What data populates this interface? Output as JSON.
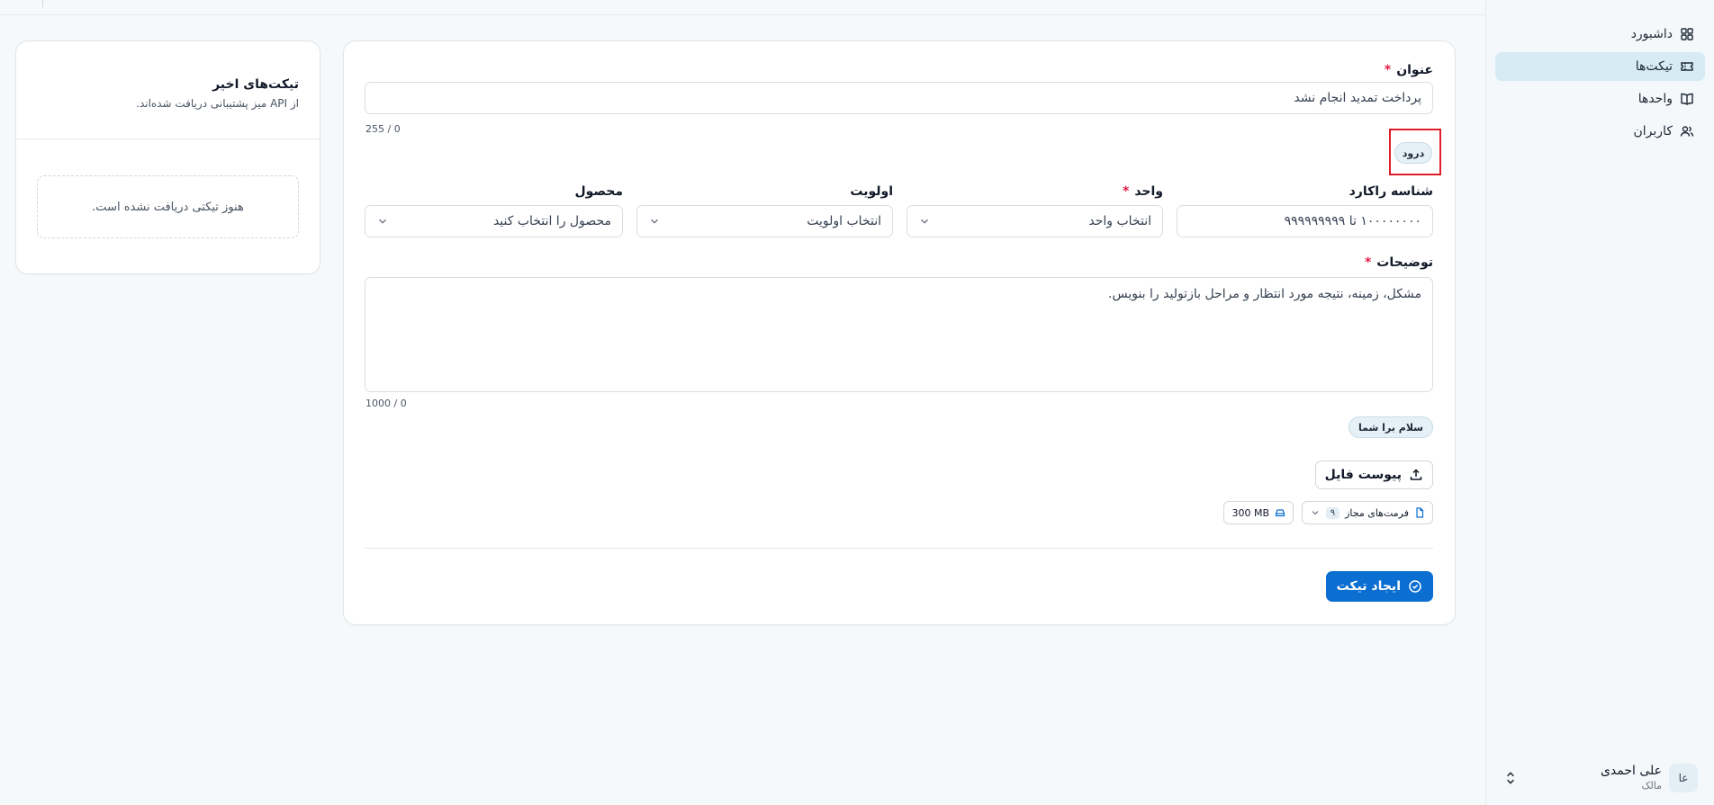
{
  "sidebar": {
    "items": [
      {
        "label": "داشبورد",
        "icon": "dashboard-icon",
        "active": false
      },
      {
        "label": "تیکت‌ها",
        "icon": "ticket-icon",
        "active": true
      },
      {
        "label": "واحدها",
        "icon": "book-icon",
        "active": false
      },
      {
        "label": "کاربران",
        "icon": "users-icon",
        "active": false
      }
    ],
    "user": {
      "initials": "عا",
      "name": "علی احمدی",
      "role": "مالک"
    }
  },
  "form": {
    "title_label": "عنوان",
    "title_value": "پرداخت تمدید انجام نشد",
    "title_counter": "255 / 0",
    "greeting_chip": "درود",
    "rakard_label": "شناسه راکارد",
    "rakard_placeholder": "۱۰۰۰۰۰۰۰۰ تا ۹۹۹۹۹۹۹۹۹",
    "unit_label": "واحد",
    "unit_placeholder": "انتخاب واحد",
    "priority_label": "اولویت",
    "priority_placeholder": "انتخاب اولویت",
    "product_label": "محصول",
    "product_placeholder": "محصول را انتخاب کنید",
    "description_label": "توضیحات",
    "description_placeholder": "مشکل، زمینه، نتیجه مورد انتظار و مراحل بازتولید را بنویس.",
    "description_counter": "1000 / 0",
    "hello_chip": "سلام برا شما",
    "attach_button": "پیوست فایل",
    "formats_label": "فرمت‌های مجاز",
    "formats_count": "۹",
    "max_size": "300 MB",
    "submit_button": "ایجاد تیکت"
  },
  "recent": {
    "title": "تیکت‌های اخیر",
    "subtitle": "از API میز پشتیبانی دریافت شده‌اند.",
    "empty": "هنوز تیکتی دریافت نشده است."
  },
  "colors": {
    "primary": "#0b6fd1",
    "required": "#e11d48",
    "highlight": "#e11d2a",
    "active_nav": "#d7ebf5"
  }
}
